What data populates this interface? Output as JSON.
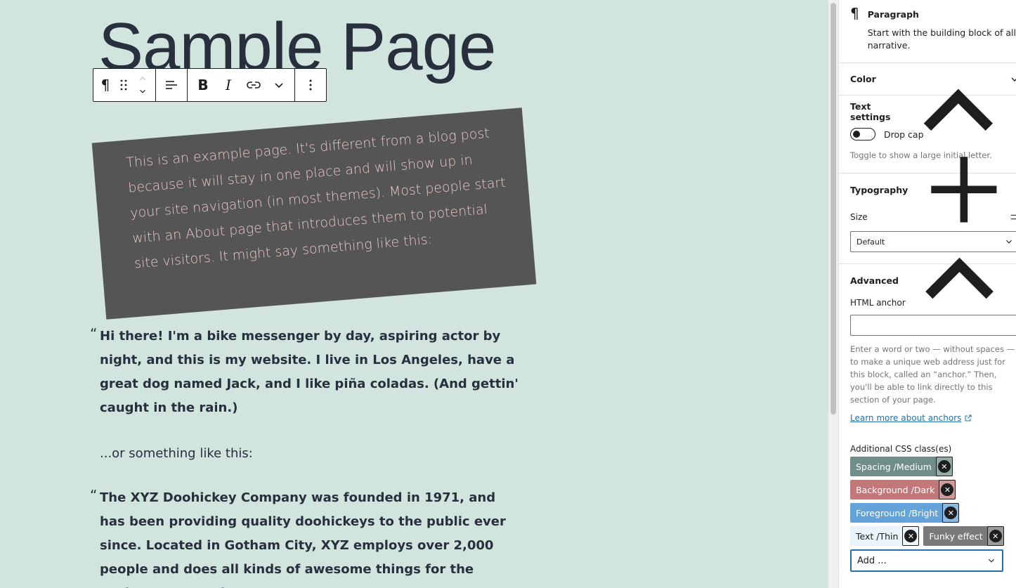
{
  "editor": {
    "page_title": "Sample Page",
    "funky_paragraph": "This is an example page. It's different from a blog post because it will stay in one place and will show up in your site navigation (in most themes). Most people start with an About page that introduces them to potential site visitors. It might say something like this:",
    "quote1": "Hi there! I'm a bike messenger by day, aspiring actor by night, and this is my website. I live in Los Angeles, have a great dog named Jack, and I like piña coladas. (And gettin' caught in the rain.)",
    "para": "...or something like this:",
    "quote2": "The XYZ Doohickey Company was founded in 1971, and has been providing quality doohickeys to the public ever since. Located in Gotham City, XYZ employs over 2,000 people and does all kinds of awesome things for the Gotham community.",
    "quote_mark": "“"
  },
  "sidebar": {
    "block_title": "Paragraph",
    "block_desc_line1": "Start with the building block of all",
    "block_desc_line2": "narrative.",
    "color_label": "Color",
    "text_settings_label": "Text settings",
    "drop_cap_label": "Drop cap",
    "drop_cap_help": "Toggle to show a large initial letter.",
    "typography_label": "Typography",
    "size_label": "Size",
    "size_value": "Default",
    "advanced_label": "Advanced",
    "html_anchor_label": "HTML anchor",
    "html_anchor_help": "Enter a word or two — without spaces — to make a unique web address just for this block, called an “anchor.” Then, you'll be able to link directly to this section of your page.",
    "learn_more_link": "Learn more about anchors",
    "css_classes_label": "Additional CSS class(es)",
    "css_tokens": [
      "Spacing /Medium",
      "Background /Dark",
      "Foreground /Bright",
      "Text /Thin",
      "Funky effect"
    ],
    "add_placeholder": "Add ..."
  }
}
